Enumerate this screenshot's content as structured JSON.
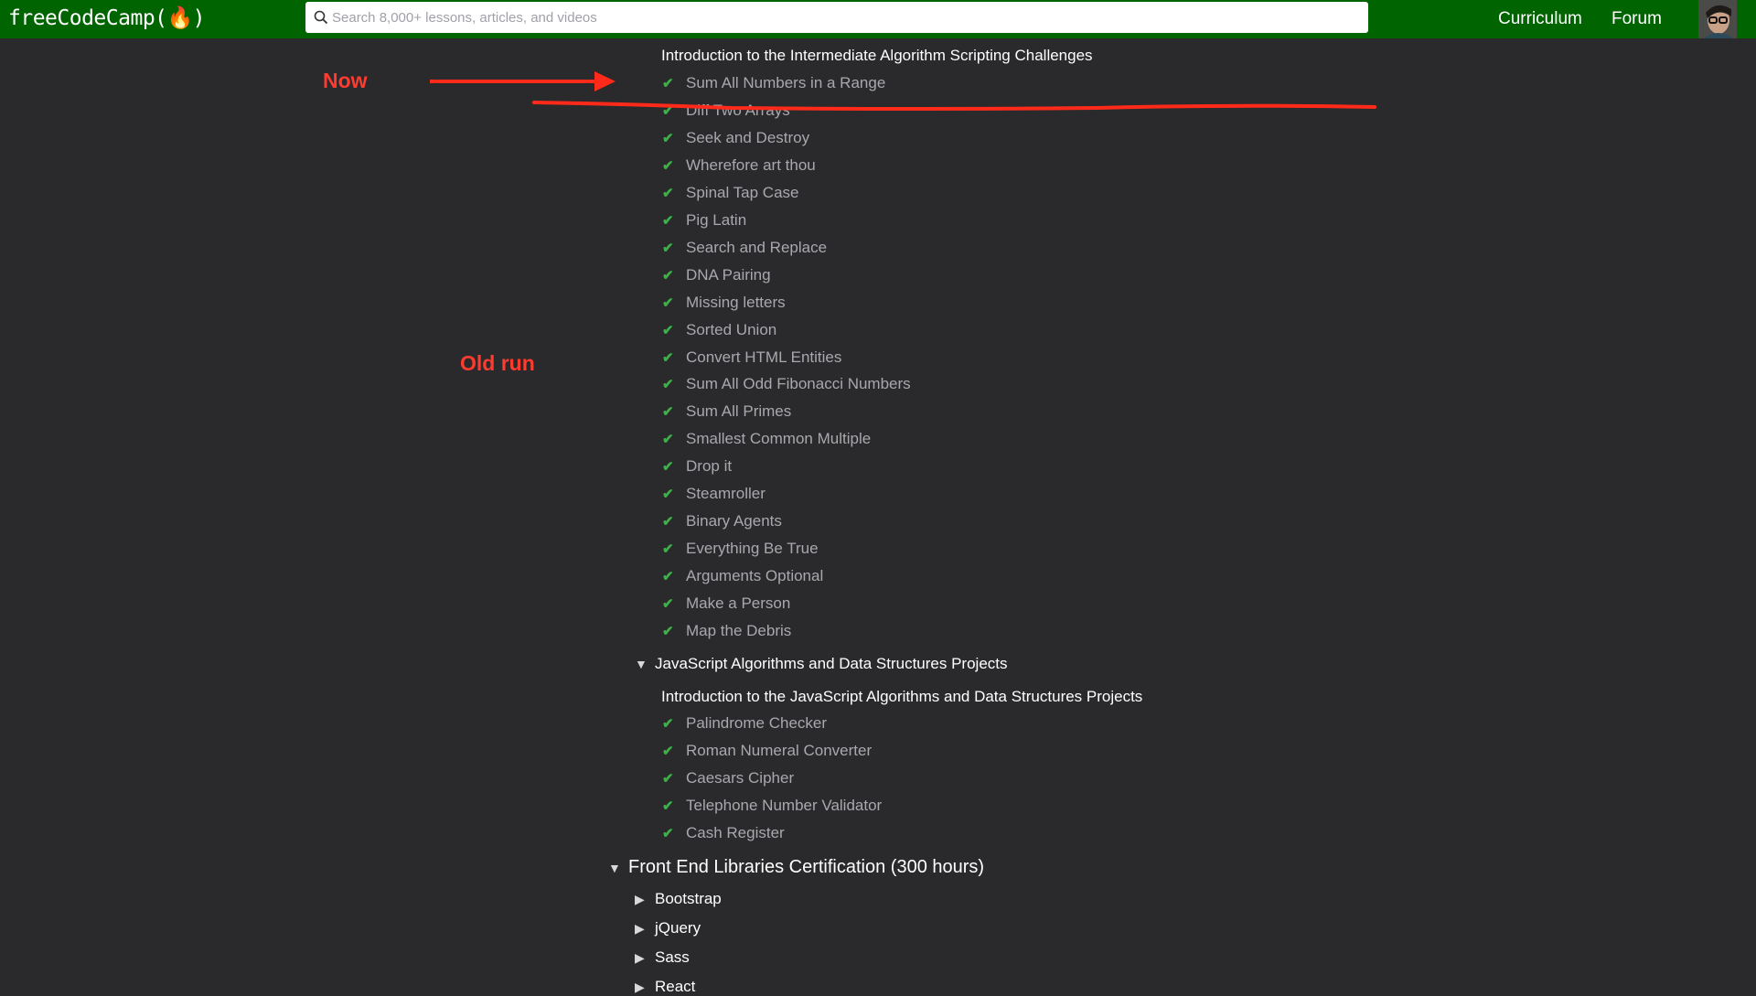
{
  "navbar": {
    "logo": "freeCodeCamp(🔥)",
    "search_placeholder": "Search 8,000+ lessons, articles, and videos",
    "links": [
      "Curriculum",
      "Forum"
    ]
  },
  "annotations": {
    "now": "Now",
    "old_run": "Old run"
  },
  "intermediate": {
    "heading": "Introduction to the Intermediate Algorithm Scripting Challenges",
    "challenges": [
      "Sum All Numbers in a Range",
      "Diff Two Arrays",
      "Seek and Destroy",
      "Wherefore art thou",
      "Spinal Tap Case",
      "Pig Latin",
      "Search and Replace",
      "DNA Pairing",
      "Missing letters",
      "Sorted Union",
      "Convert HTML Entities",
      "Sum All Odd Fibonacci Numbers",
      "Sum All Primes",
      "Smallest Common Multiple",
      "Drop it",
      "Steamroller",
      "Binary Agents",
      "Everything Be True",
      "Arguments Optional",
      "Make a Person",
      "Map the Debris"
    ]
  },
  "projects": {
    "section": "JavaScript Algorithms and Data Structures Projects",
    "heading": "Introduction to the JavaScript Algorithms and Data Structures Projects",
    "challenges": [
      "Palindrome Checker",
      "Roman Numeral Converter",
      "Caesars Cipher",
      "Telephone Number Validator",
      "Cash Register"
    ]
  },
  "front_end": {
    "cert": "Front End Libraries Certification (300 hours)",
    "sections": [
      "Bootstrap",
      "jQuery",
      "Sass",
      "React"
    ]
  },
  "colors": {
    "navbar": "#006400",
    "background": "#2a2a2c",
    "check": "#3eb04a",
    "annotation": "#ff3b30"
  }
}
